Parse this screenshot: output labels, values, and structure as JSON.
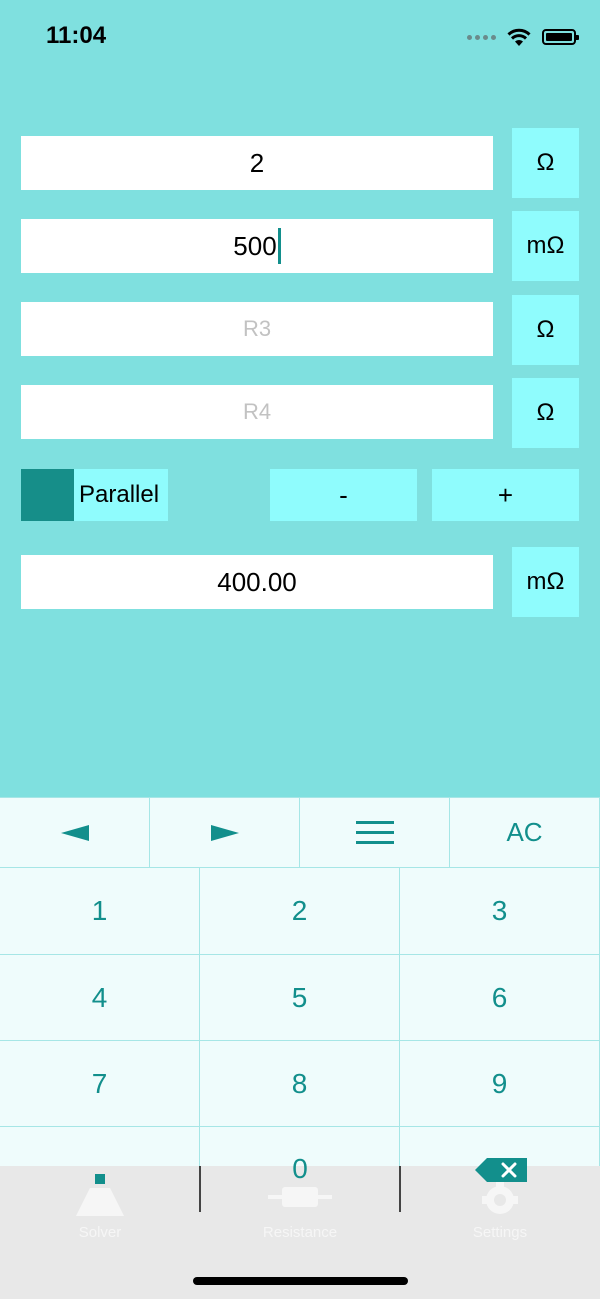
{
  "status": {
    "time": "11:04"
  },
  "inputs": [
    {
      "value": "2",
      "placeholder": "",
      "unit": "Ω"
    },
    {
      "value": "500",
      "placeholder": "",
      "unit": "mΩ",
      "focused": true
    },
    {
      "value": "",
      "placeholder": "R3",
      "unit": "Ω"
    },
    {
      "value": "",
      "placeholder": "R4",
      "unit": "Ω"
    }
  ],
  "mode": {
    "label": "Parallel",
    "minus_label": "-",
    "plus_label": "+"
  },
  "result": {
    "value": "400.00",
    "unit": "mΩ"
  },
  "keyboard": {
    "top_row": {
      "left": "left-arrow-icon",
      "right": "right-arrow-icon",
      "menu": "menu-icon",
      "clear": "AC"
    },
    "digits": [
      "1",
      "2",
      "3",
      "4",
      "5",
      "6",
      "7",
      "8",
      "9",
      "0"
    ]
  },
  "tabs": [
    {
      "label": "Solver",
      "icon": "solver-icon"
    },
    {
      "label": "Resistance",
      "icon": "resistor-icon"
    },
    {
      "label": "Settings",
      "icon": "gear-icon"
    }
  ],
  "colors": {
    "background": "#7fe0df",
    "button": "#8ffcfd",
    "accent": "#128f8c",
    "keyboard": "#effcfc"
  }
}
